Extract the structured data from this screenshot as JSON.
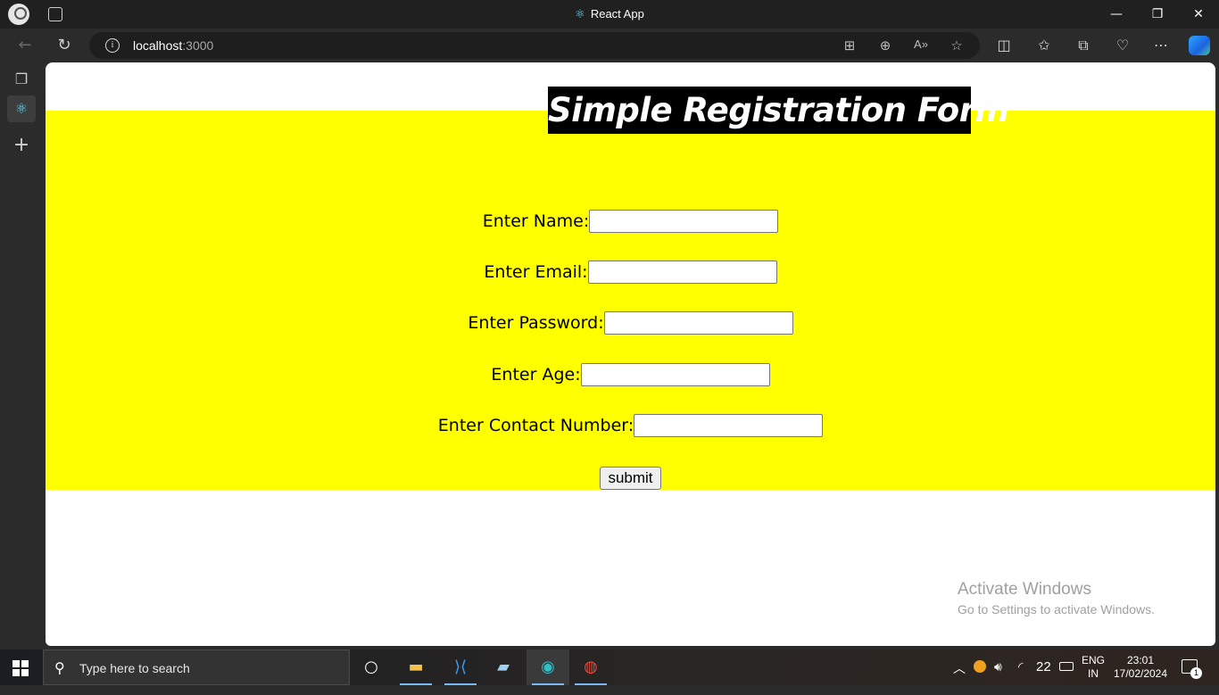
{
  "browser": {
    "window_title": "React App",
    "url_host": "localhost",
    "url_port": ":3000"
  },
  "page": {
    "heading": "Simple Registration Form",
    "fields": [
      {
        "label": "Enter Name:",
        "value": ""
      },
      {
        "label": "Enter Email:",
        "value": ""
      },
      {
        "label": "Enter Password:",
        "value": ""
      },
      {
        "label": "Enter Age:",
        "value": ""
      },
      {
        "label": "Enter Contact Number:",
        "value": ""
      }
    ],
    "submit_label": "submit",
    "background_color": "#ffff00",
    "heading_bg_color": "#000000"
  },
  "watermark": {
    "line1": "Activate Windows",
    "line2": "Go to Settings to activate Windows."
  },
  "taskbar": {
    "search_placeholder": "Type here to search",
    "apps": [
      "cortana-icon",
      "file-explorer-icon",
      "vscode-icon",
      "notepad-icon",
      "edge-icon",
      "chrome-icon"
    ],
    "lang_line1": "ENG",
    "lang_line2": "IN",
    "temperature": "22",
    "time": "23:01",
    "date": "17/02/2024",
    "notification_count": "1"
  }
}
